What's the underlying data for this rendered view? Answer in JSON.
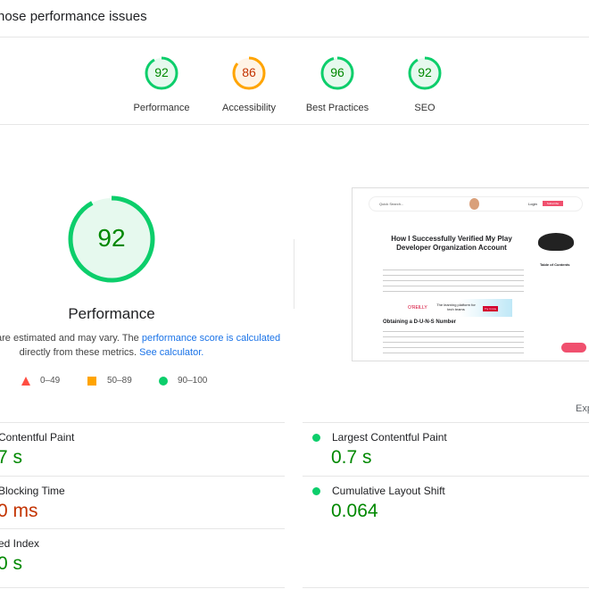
{
  "header": {
    "title": "hose performance issues"
  },
  "colors": {
    "pass": "#0cce6b",
    "average": "#ffa400",
    "fail": "#ff4e42",
    "pass_text": "#008800",
    "average_text": "#c33300"
  },
  "categories": [
    {
      "label": "Performance",
      "score": 92,
      "status": "pass"
    },
    {
      "label": "Accessibility",
      "score": 86,
      "status": "average"
    },
    {
      "label": "Best Practices",
      "score": 96,
      "status": "pass"
    },
    {
      "label": "SEO",
      "score": 92,
      "status": "pass"
    }
  ],
  "main_gauge": {
    "score": 92,
    "label": "Performance"
  },
  "note": {
    "text1": "are estimated and may vary. The ",
    "link1": "performance score is calculated",
    "text2": "directly from these metrics. ",
    "link2": "See calculator."
  },
  "legend": [
    {
      "range": "0–49",
      "shape": "triangle"
    },
    {
      "range": "50–89",
      "shape": "square"
    },
    {
      "range": "90–100",
      "shape": "circle"
    }
  ],
  "screenshot": {
    "search": "Quick Search...",
    "login": "Login",
    "subscribe": "Subscribe",
    "title": "How I Successfully Verified My Play Developer Organization Account",
    "toc": "Table of Contents",
    "h2": "Obtaining a D-U-N-S Number",
    "ad_brand": "O'REILLY",
    "ad_text": "The learning platform for tech teams",
    "ad_btn": "Try it now"
  },
  "expand": "Exp",
  "metrics_left": [
    {
      "label": " Contentful Paint",
      "value": "7 s",
      "status": "pass"
    },
    {
      "label": " Blocking Time",
      "value": "0 ms",
      "status": "average"
    },
    {
      "label": "ed Index",
      "value": "0 s",
      "status": "pass"
    }
  ],
  "metrics_right": [
    {
      "label": "Largest Contentful Paint",
      "value": "0.7 s",
      "status": "pass"
    },
    {
      "label": "Cumulative Layout Shift",
      "value": "0.064",
      "status": "pass"
    }
  ]
}
